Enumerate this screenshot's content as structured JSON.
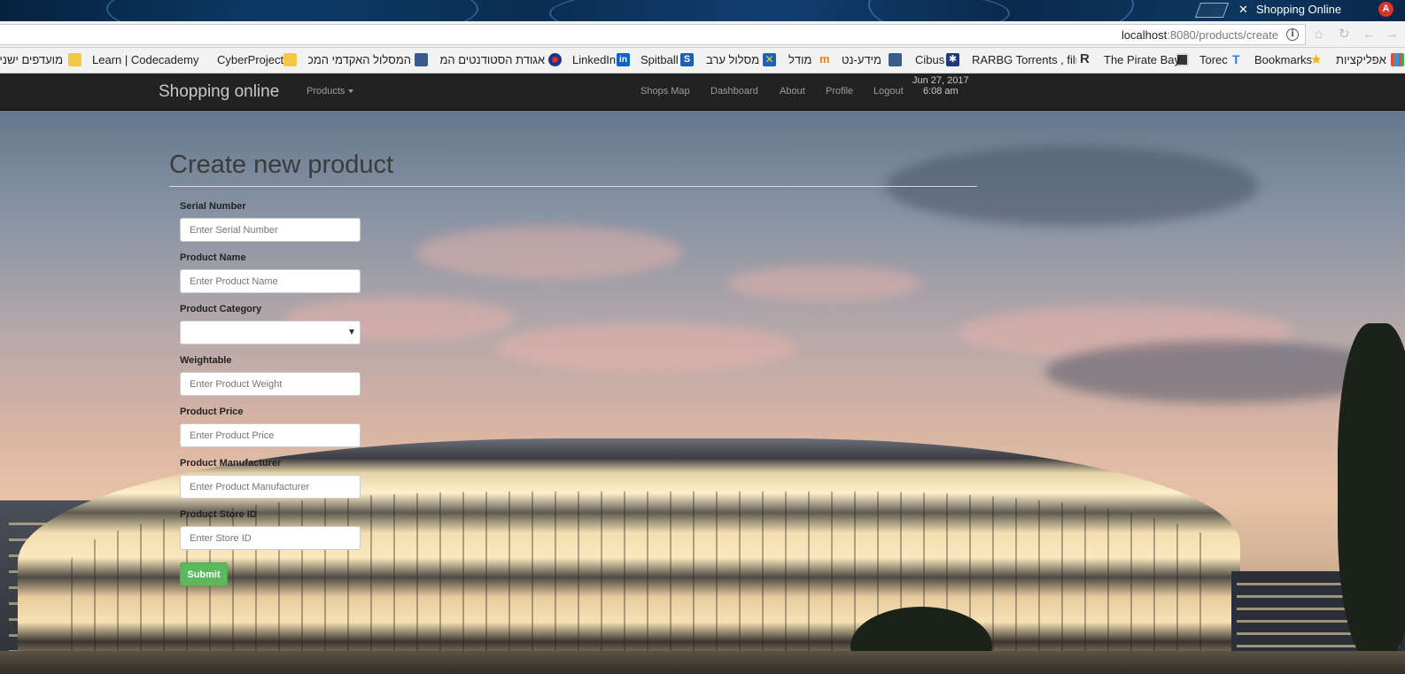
{
  "browser": {
    "tab_title": "Shopping Online",
    "tab_close_glyph": "✕",
    "extension_badge": "A",
    "url_host": "localhost",
    "url_path": ":8080/products/create",
    "info_glyph": "i"
  },
  "bookmarks": [
    {
      "label": "אפליקציות",
      "icon": "apps-grid-icon"
    },
    {
      "label": "Bookmarks",
      "icon": "star-icon"
    },
    {
      "label": "Torec",
      "icon": "torec-icon"
    },
    {
      "label": "The Pirate Bay",
      "icon": "pirate-bay-icon"
    },
    {
      "label": "RARBG Torrents , film",
      "icon": "rarbg-icon"
    },
    {
      "label": "Cibus",
      "icon": "cibus-icon"
    },
    {
      "label": "מידע-נט",
      "icon": "mida-net-icon"
    },
    {
      "label": "מודל",
      "icon": "moodle-icon"
    },
    {
      "label": "מסלול ערב",
      "icon": "evening-track-icon"
    },
    {
      "label": "Spitball",
      "icon": "spitball-icon"
    },
    {
      "label": "LinkedIn",
      "icon": "linkedin-icon"
    },
    {
      "label": "אגודת הסטודנטים המ",
      "icon": "student-union-icon"
    },
    {
      "label": "המסלול האקדמי המכ",
      "icon": "academic-track-icon"
    },
    {
      "label": "CyberProject",
      "icon": "folder-icon"
    },
    {
      "label": "Learn | Codecademy",
      "icon": "codecademy-icon"
    },
    {
      "label": "מועדפים ישנים",
      "icon": "folder-icon"
    }
  ],
  "navbar": {
    "brand": "Shopping online",
    "products_label": "Products",
    "links": [
      "Shops Map",
      "Dashboard",
      "About",
      "Profile",
      "Logout"
    ],
    "date": "Jun 27, 2017",
    "time": "6:08 am"
  },
  "form": {
    "title": "Create new product",
    "fields": [
      {
        "label": "Serial Number",
        "placeholder": "Enter Serial Number",
        "kind": "text"
      },
      {
        "label": "Product Name",
        "placeholder": "Enter Product Name",
        "kind": "text"
      },
      {
        "label": "Product Category",
        "placeholder": "",
        "kind": "select"
      },
      {
        "label": "Weightable",
        "placeholder": "Enter Product Weight",
        "kind": "text"
      },
      {
        "label": "Product Price",
        "placeholder": "Enter Product Price",
        "kind": "text"
      },
      {
        "label": "Product Manufacturer",
        "placeholder": "Enter Product Manufacturer",
        "kind": "text"
      },
      {
        "label": "Product Store ID",
        "placeholder": "Enter Store ID",
        "kind": "text"
      }
    ],
    "submit_label": "Submit"
  },
  "colors": {
    "navbar_bg": "#222222",
    "submit_bg": "#5cb85c",
    "title_color": "#3b3b3b"
  }
}
